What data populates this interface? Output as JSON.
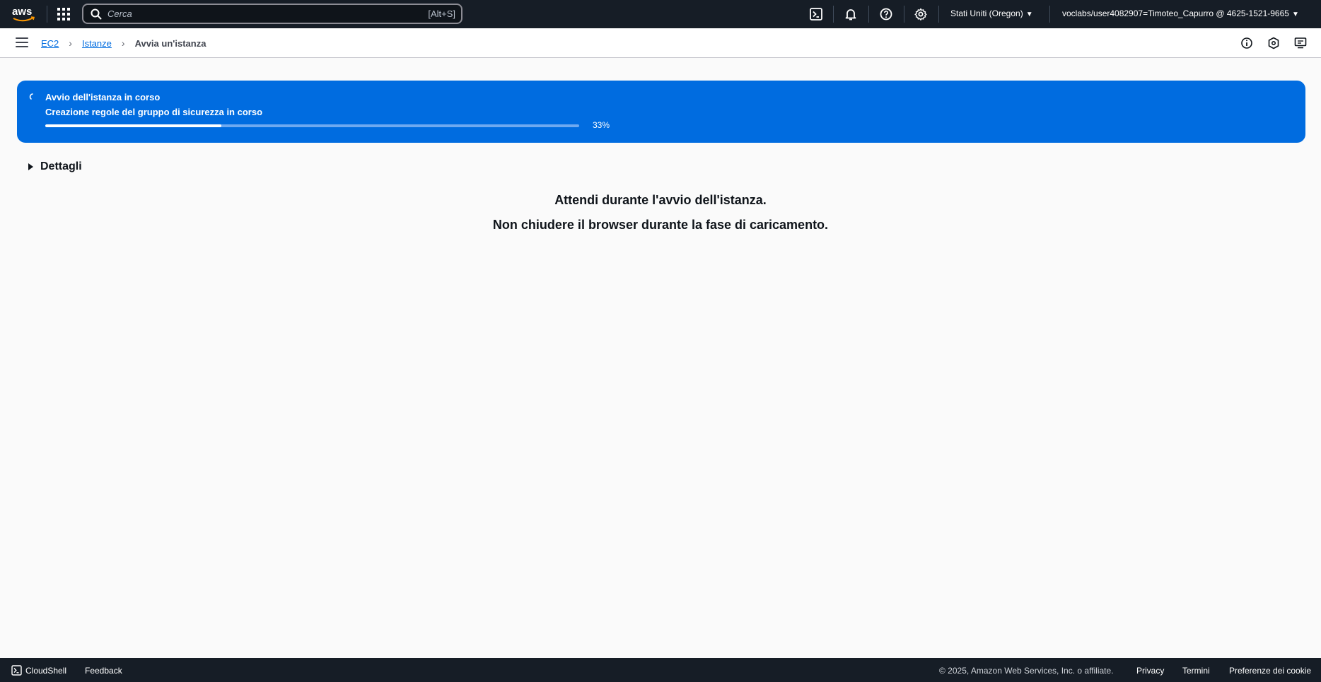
{
  "topbar": {
    "logo_text": "aws",
    "search_placeholder": "Cerca",
    "search_shortcut": "[Alt+S]",
    "region": "Stati Uniti (Oregon)",
    "account": "voclabs/user4082907=Timoteo_Capurro @ 4625-1521-9665",
    "icons": [
      "cloudshell-icon",
      "bell-icon",
      "help-icon",
      "gear-icon"
    ]
  },
  "breadcrumb": {
    "items": [
      {
        "label": "EC2"
      },
      {
        "label": "Istanze"
      }
    ],
    "current": "Avvia un'istanza"
  },
  "flash": {
    "title": "Avvio dell'istanza in corso",
    "subtitle": "Creazione regole del gruppo di sicurezza in corso",
    "progress": 0.33,
    "progress_label": "33%",
    "color": "#006ce0"
  },
  "details": {
    "label": "Dettagli"
  },
  "main": {
    "line1": "Attendi durante l'avvio dell'istanza.",
    "line2": "Non chiudere il browser durante la fase di caricamento."
  },
  "footer": {
    "cloudshell": "CloudShell",
    "feedback": "Feedback",
    "copyright": "© 2025, Amazon Web Services, Inc. o affiliate.",
    "links": [
      "Privacy",
      "Termini",
      "Preferenze dei cookie"
    ]
  }
}
